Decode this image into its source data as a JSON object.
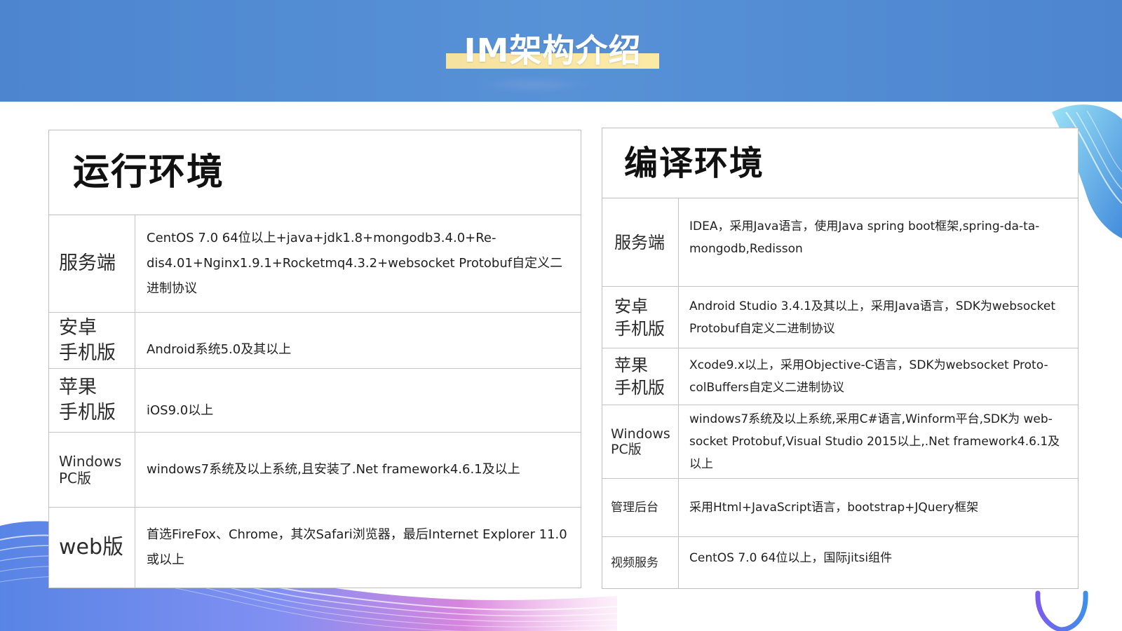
{
  "header": {
    "title": "IM架构介绍"
  },
  "colors": {
    "header_bg": "#4d86cf",
    "title_highlight": "#f6e2a0",
    "panel_border": "#bfbfbf",
    "text": "#1a1a1a"
  },
  "runtime": {
    "title": "运行环境",
    "rows": [
      {
        "label": "服务端",
        "content": "CentOS 7.0 64位以上+java+jdk1.8+mongodb3.4.0+Re-dis4.01+Nginx1.9.1+Rocketmq4.3.2+websocket Protobuf自定义二进制协议"
      },
      {
        "label": "安卓\n手机版",
        "content": "Android系统5.0及其以上"
      },
      {
        "label": "苹果\n手机版",
        "content": "iOS9.0以上"
      },
      {
        "label": "Windows\nPC版",
        "content": "windows7系统及以上系统,且安装了.Net framework4.6.1及以上"
      },
      {
        "label": "web版",
        "content": "首选FireFox、Chrome，其次Safari浏览器，最后Internet Explorer 11.0或以上"
      }
    ]
  },
  "compile": {
    "title": "编译环境",
    "rows": [
      {
        "label": "服务端",
        "content": "IDEA，采用Java语言，使用Java spring boot框架,spring-da-ta-mongodb,Redisson"
      },
      {
        "label": "安卓\n手机版",
        "content": "Android Studio 3.4.1及其以上，采用Java语言，SDK为websocket Protobuf自定义二进制协议"
      },
      {
        "label": "苹果\n手机版",
        "content": "Xcode9.x以上，采用Objective-C语言，SDK为websocket Proto-colBuffers自定义二进制协议"
      },
      {
        "label": "Windows\nPC版",
        "content": "windows7系统及以上系统,采用C#语言,Winform平台,SDK为 web-socket Protobuf,Visual Studio 2015以上,.Net framework4.6.1及以上"
      },
      {
        "label": "管理后台",
        "content": "采用Html+JavaScript语言，bootstrap+JQuery框架"
      },
      {
        "label": "视频服务",
        "content": "CentOS 7.0 64位以上，国际jitsi组件"
      }
    ]
  }
}
